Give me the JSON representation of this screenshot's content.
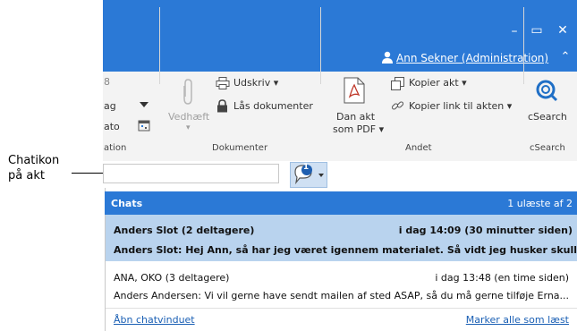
{
  "window": {
    "minimize_icon": "–",
    "maximize_icon": "▭",
    "close_icon": "✕",
    "collapse_icon": "⌃"
  },
  "user": {
    "name": "Ann Sekner (Administration)"
  },
  "ribbon": {
    "partial": {
      "item1": "ag",
      "item2": "ato",
      "group": "ation"
    },
    "vedhaeft": "Vedhæft",
    "udskriv": "Udskriv ▾",
    "laas": "Lås dokumenter",
    "dokumenter_group": "Dokumenter",
    "dan_akt_1": "Dan akt",
    "dan_akt_2": "som PDF ▾",
    "kopier_akt": "Kopier akt ▾",
    "kopier_link": "Kopier link til akten ▾",
    "andet_group": "Andet",
    "csearch": "cSearch",
    "csearch_group": "cSearch"
  },
  "callout": {
    "line1": "Chatikon",
    "line2": "på akt"
  },
  "chat_icon": {
    "badge": "1"
  },
  "chats": {
    "title": "Chats",
    "unread": "1 ulæste af 2",
    "items": [
      {
        "participants": "Anders Slot (2 deltagere)",
        "time": "i dag 14:09 (30 minutter siden)",
        "message": "Anders Slot: Hej Ann, så har jeg været igennem materialet. Så vidt jeg husker skulle..."
      },
      {
        "participants": "ANA, OKO (3 deltagere)",
        "time": "i dag 13:48 (en time siden)",
        "message": "Anders Andersen: Vi vil gerne have sendt mailen af sted ASAP, så du må gerne tilføje Erna..."
      }
    ],
    "open_link": "Åbn chatvinduet",
    "mark_all": "Marker alle som læst"
  },
  "colors": {
    "accent": "#2b79d6",
    "selected_row": "#b9d3ee"
  }
}
